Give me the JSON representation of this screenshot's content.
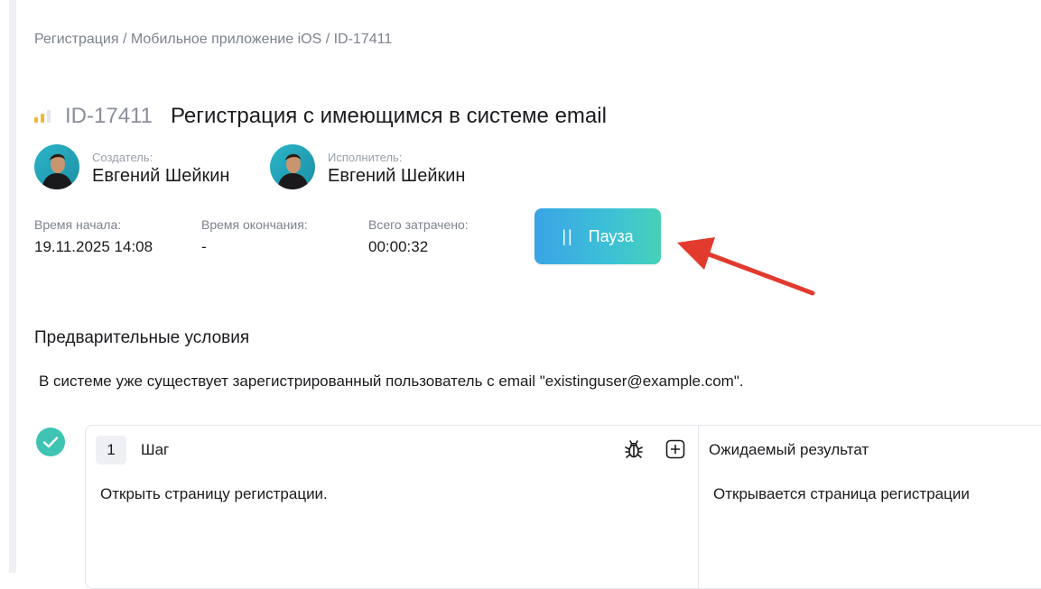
{
  "breadcrumb": "Регистрация / Мобильное приложение iOS / ID-17411",
  "task": {
    "id": "ID-17411",
    "title": "Регистрация с имеющимся в системе email",
    "priority_icon": "priority-bars-icon",
    "priority_color": "#f5b731"
  },
  "creator": {
    "role": "Создатель:",
    "name": "Евгений Шейкин",
    "avatar": "avatar-photo"
  },
  "assignee": {
    "role": "Исполнитель:",
    "name": "Евгений Шейкин",
    "avatar": "avatar-photo"
  },
  "times": {
    "start_label": "Время начала:",
    "start_value": "19.11.2025 14:08",
    "end_label": "Время окончания:",
    "end_value": "-",
    "total_label": "Всего затрачено:",
    "total_value": "00:00:32"
  },
  "pause_button": {
    "icon": "||",
    "label": "Пауза"
  },
  "annotation": {
    "icon": "red-arrow-icon",
    "color": "#e23b2e"
  },
  "preconditions": {
    "title": "Предварительные условия",
    "text": "В системе уже существует зарегистрированный пользователь с email \"existinguser@example.com\"."
  },
  "steps": [
    {
      "number": "1",
      "step_label": "Шаг",
      "expected_label": "Ожидаемый результат",
      "action": "Открыть страницу регистрации.",
      "expected": "Открывается страница регистрации",
      "status_icon": "check-circle-icon",
      "status_color": "#3fc4b3"
    }
  ]
}
